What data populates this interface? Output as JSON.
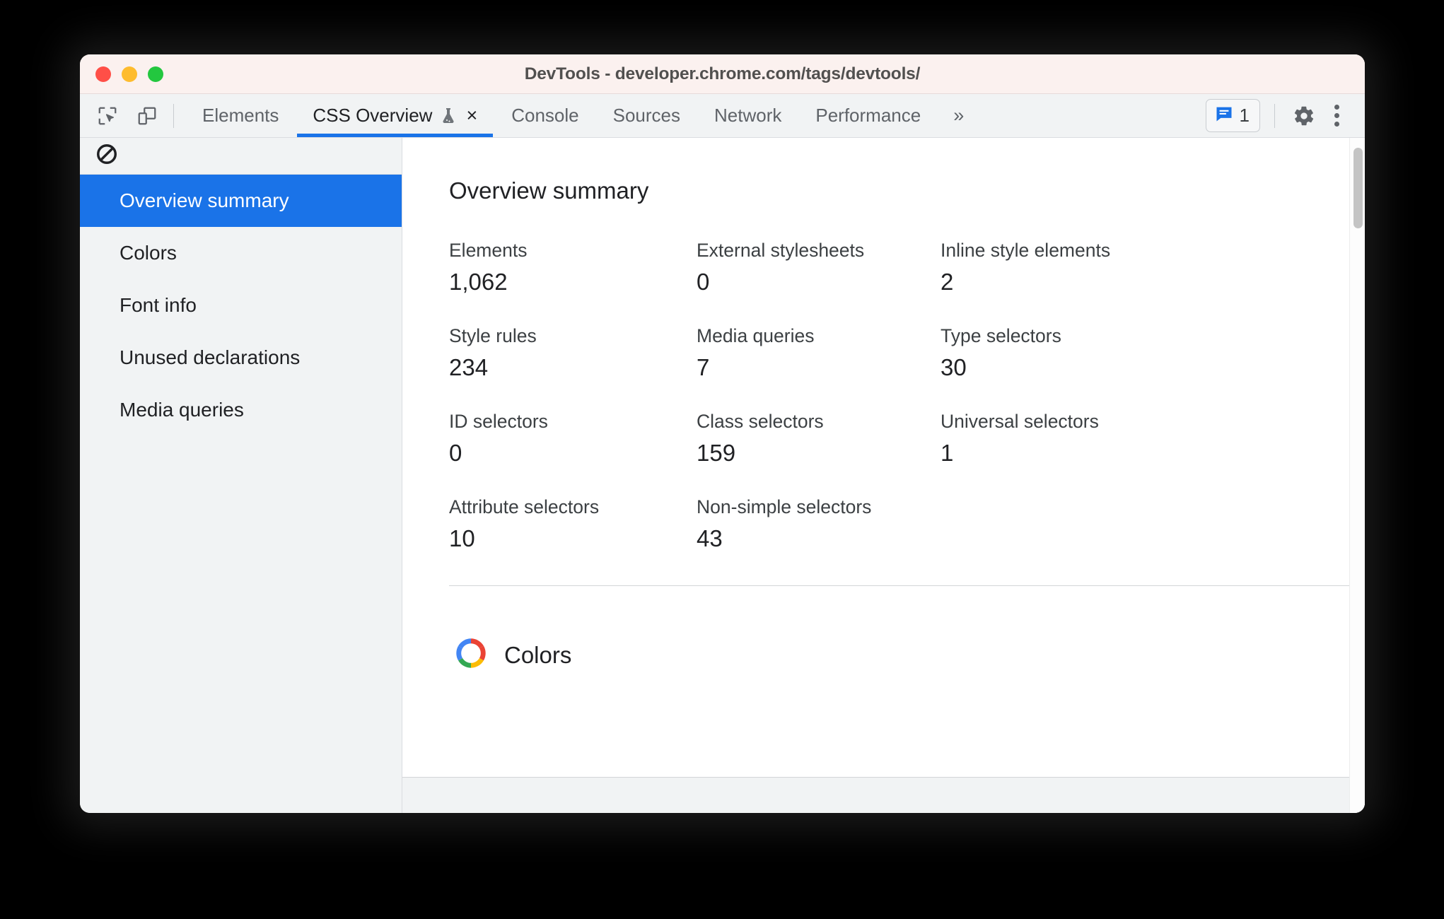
{
  "window": {
    "title": "DevTools - developer.chrome.com/tags/devtools/",
    "controls": {
      "close": "close-window",
      "minimize": "minimize-window",
      "maximize": "maximize-window"
    },
    "colors": {
      "titlebar_bg": "#fbf1ef",
      "close": "#ff4f47",
      "minimize": "#febc2e",
      "maximize": "#23c73f"
    }
  },
  "toolbar": {
    "inspect_icon": "inspect-element-icon",
    "device_icon": "device-toolbar-icon",
    "overflow_label": "»",
    "messages": {
      "icon": "console-message-icon",
      "count": "1"
    },
    "settings_icon": "gear-icon",
    "more_icon": "kebab-menu-icon",
    "accent": "#1a73e8"
  },
  "tabs": [
    {
      "label": "Elements",
      "active": false
    },
    {
      "label": "CSS Overview",
      "active": true,
      "experiment_icon": "flask-icon",
      "close_label": "×"
    },
    {
      "label": "Console",
      "active": false
    },
    {
      "label": "Sources",
      "active": false
    },
    {
      "label": "Network",
      "active": false
    },
    {
      "label": "Performance",
      "active": false
    }
  ],
  "sidebar": {
    "clear_icon": "no-entry-icon",
    "items": [
      {
        "label": "Overview summary",
        "selected": true
      },
      {
        "label": "Colors",
        "selected": false
      },
      {
        "label": "Font info",
        "selected": false
      },
      {
        "label": "Unused declarations",
        "selected": false
      },
      {
        "label": "Media queries",
        "selected": false
      }
    ]
  },
  "main": {
    "heading": "Overview summary",
    "stats": [
      {
        "label": "Elements",
        "value": "1,062"
      },
      {
        "label": "External stylesheets",
        "value": "0"
      },
      {
        "label": "Inline style elements",
        "value": "2"
      },
      {
        "label": "Style rules",
        "value": "234"
      },
      {
        "label": "Media queries",
        "value": "7"
      },
      {
        "label": "Type selectors",
        "value": "30"
      },
      {
        "label": "ID selectors",
        "value": "0"
      },
      {
        "label": "Class selectors",
        "value": "159"
      },
      {
        "label": "Universal selectors",
        "value": "1"
      },
      {
        "label": "Attribute selectors",
        "value": "10"
      },
      {
        "label": "Non-simple selectors",
        "value": "43"
      },
      {
        "label": "",
        "value": ""
      }
    ],
    "colors_section": {
      "label": "Colors",
      "icon": "color-wheel-icon"
    }
  }
}
